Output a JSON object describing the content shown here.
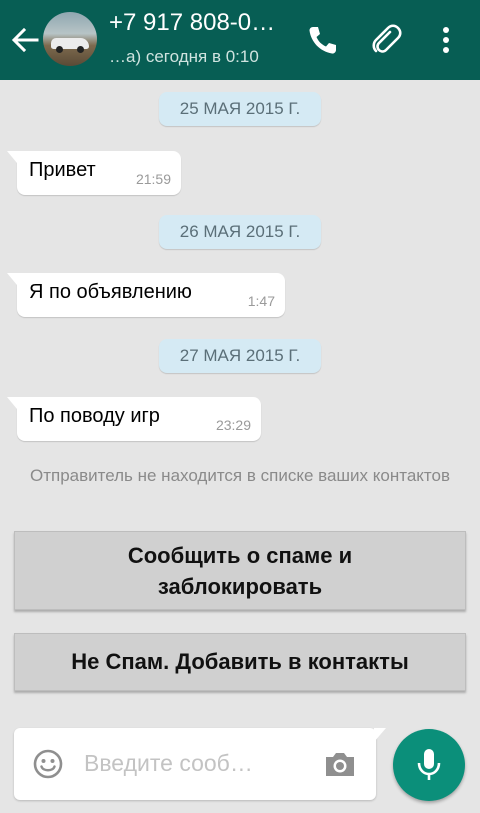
{
  "header": {
    "contact_name": "+7 917 808-0…",
    "status": "…а) сегодня в 0:10",
    "icons": [
      "back-arrow-icon",
      "phone-icon",
      "paperclip-icon",
      "more-vert-icon"
    ],
    "color": "#075e54"
  },
  "messages": [
    {
      "date": "25 МАЯ 2015 Г.",
      "text": "Привет",
      "time": "21:59"
    },
    {
      "date": "26 МАЯ 2015 Г.",
      "text": "Я по объявлению",
      "time": "1:47"
    },
    {
      "date": "27 МАЯ 2015 Г.",
      "text": "По поводу игр",
      "time": "23:29"
    }
  ],
  "notice": "Отправитель не находится в списке ваших контактов",
  "actions": {
    "report_label": "Сообщить о спаме и заблокировать",
    "not_spam_label": "Не Спам. Добавить в контакты"
  },
  "composer": {
    "placeholder": "Введите сооб…",
    "value": "",
    "icons": [
      "emoji-icon",
      "camera-icon",
      "mic-icon"
    ],
    "send_color": "#0b8f7a"
  }
}
